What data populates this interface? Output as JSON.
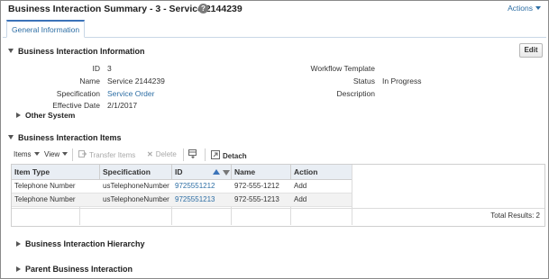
{
  "header": {
    "title": "Business Interaction Summary - 3 - Service 2144239",
    "help_icon": "question-icon",
    "actions_label": "Actions"
  },
  "tabs": [
    {
      "label": "General Information",
      "selected": true
    }
  ],
  "info_section": {
    "title": "Business Interaction Information",
    "edit_label": "Edit",
    "fields_left": [
      {
        "label": "ID",
        "value": "3"
      },
      {
        "label": "Name",
        "value": "Service 2144239"
      },
      {
        "label": "Specification",
        "value": "Service Order"
      },
      {
        "label": "Effective Date",
        "value": "2/1/2017"
      }
    ],
    "fields_right": [
      {
        "label": "Workflow Template",
        "value": ""
      },
      {
        "label": "Status",
        "value": "In Progress"
      },
      {
        "label": "Description",
        "value": ""
      }
    ]
  },
  "other_system": {
    "title": "Other System"
  },
  "items_section": {
    "title": "Business Interaction Items",
    "toolbar": {
      "items_menu": "Items",
      "view_menu": "View",
      "transfer_items": "Transfer Items",
      "delete": "Delete",
      "detach": "Detach"
    },
    "columns": [
      "Item Type",
      "Specification",
      "ID",
      "Name",
      "Action"
    ],
    "rows": [
      {
        "item_type": "Telephone Number",
        "specification": "usTelephoneNumber",
        "id": "9725551212",
        "name": "972-555-1212",
        "action": "Add"
      },
      {
        "item_type": "Telephone Number",
        "specification": "usTelephoneNumber",
        "id": "9725551213",
        "name": "972-555-1213",
        "action": "Add"
      }
    ],
    "total_results": "Total Results: 2"
  },
  "hierarchy_section": {
    "title": "Business Interaction Hierarchy"
  },
  "parent_section": {
    "title": "Parent Business Interaction"
  },
  "colors": {
    "link": "#2d6ea4",
    "tab_accent": "#3b73b9",
    "header_bg": "#e9eef4"
  }
}
